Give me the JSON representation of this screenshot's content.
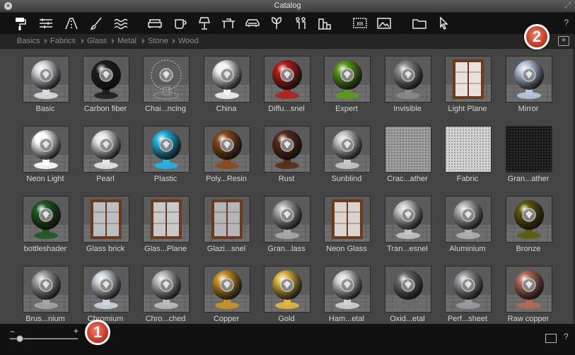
{
  "window": {
    "title": "Catalog"
  },
  "toolbar": {
    "icons": [
      "paint-roller-icon",
      "layers-icon",
      "road-icon",
      "brush-icon",
      "water-icon",
      "sofa-icon",
      "cup-icon",
      "lamp-icon",
      "table-icon",
      "car-icon",
      "plant-icon",
      "people-icon",
      "buildings-icon",
      "billboard-icon",
      "image-icon",
      "folder-icon",
      "cursor-icon"
    ],
    "help_label": "?"
  },
  "breadcrumbs": [
    "Basics",
    "Fabrics",
    "Glass",
    "Metal",
    "Stone",
    "Wood"
  ],
  "materials": [
    {
      "label": "Basic",
      "style": "sphere",
      "color": "#d9dde3"
    },
    {
      "label": "Carbon fiber",
      "style": "sphere",
      "color": "#1e1e1e"
    },
    {
      "label": "Chai...ncing",
      "style": "wire",
      "color": "#cfcfcf"
    },
    {
      "label": "China",
      "style": "sphere",
      "color": "#f2f2f2"
    },
    {
      "label": "Diffu...snel",
      "style": "sphere",
      "color": "#b3201c"
    },
    {
      "label": "Expert",
      "style": "sphere",
      "color": "#5c9a1e"
    },
    {
      "label": "Invisible",
      "style": "sphere",
      "color": "#8a8a8a"
    },
    {
      "label": "Light Plane",
      "style": "window",
      "color": "#ffffff"
    },
    {
      "label": "Mirror",
      "style": "sphere",
      "color": "#b8c8dc"
    },
    {
      "label": "Neon Light",
      "style": "sphere",
      "color": "#ffffff"
    },
    {
      "label": "Pearl",
      "style": "sphere",
      "color": "#e6e6e6"
    },
    {
      "label": "Plastic",
      "style": "sphere",
      "color": "#27b3de"
    },
    {
      "label": "Poly...Resin",
      "style": "sphere",
      "color": "#8a4a1e"
    },
    {
      "label": "Rust",
      "style": "sphere",
      "color": "#5a2c1a"
    },
    {
      "label": "Sunblind",
      "style": "sphere",
      "color": "#c8c8c8"
    },
    {
      "label": "Crac...ather",
      "style": "texture",
      "color": "#9a9a9a"
    },
    {
      "label": "Fabric",
      "style": "texture",
      "color": "#d0d0d0"
    },
    {
      "label": "Gran...ather",
      "style": "texture",
      "color": "#1a1a1a"
    },
    {
      "label": "bottleshader",
      "style": "sphere",
      "color": "#1f5a24"
    },
    {
      "label": "Glass brick",
      "style": "window",
      "color": "#c9d6df"
    },
    {
      "label": "Glas...Plane",
      "style": "window",
      "color": "#d8e3ea"
    },
    {
      "label": "Glazi...snel",
      "style": "window",
      "color": "#bfcbd4"
    },
    {
      "label": "Gran...lass",
      "style": "sphere",
      "color": "#a9a9a9"
    },
    {
      "label": "Neon Glass",
      "style": "window",
      "color": "#eeeeee"
    },
    {
      "label": "Tran...esnel",
      "style": "sphere",
      "color": "#c4c4c4"
    },
    {
      "label": "Aluminium",
      "style": "sphere",
      "color": "#b0b0b0"
    },
    {
      "label": "Bronze",
      "style": "sphere",
      "color": "#5e5a10"
    },
    {
      "label": "Brus...nium",
      "style": "sphere",
      "color": "#a5a5a5"
    },
    {
      "label": "Chromium",
      "style": "sphere",
      "color": "#cfd6de"
    },
    {
      "label": "Chro...ched",
      "style": "sphere",
      "color": "#bcbcbc"
    },
    {
      "label": "Copper",
      "style": "sphere",
      "color": "#c8922a"
    },
    {
      "label": "Gold",
      "style": "sphere",
      "color": "#e0b840"
    },
    {
      "label": "Ham...etal",
      "style": "sphere",
      "color": "#d2d2d2"
    },
    {
      "label": "Oxid...etal",
      "style": "sphere",
      "color": "#6a6a6a"
    },
    {
      "label": "Perf...sheet",
      "style": "sphere",
      "color": "#9a9aa2"
    },
    {
      "label": "Raw copper",
      "style": "sphere",
      "color": "#b06a5c"
    }
  ],
  "bottombar": {
    "minus_label": "−",
    "plus_label": "+",
    "zoom_level": 0.15,
    "help_label": "?"
  },
  "badges": [
    {
      "label": "1"
    },
    {
      "label": "2"
    }
  ]
}
